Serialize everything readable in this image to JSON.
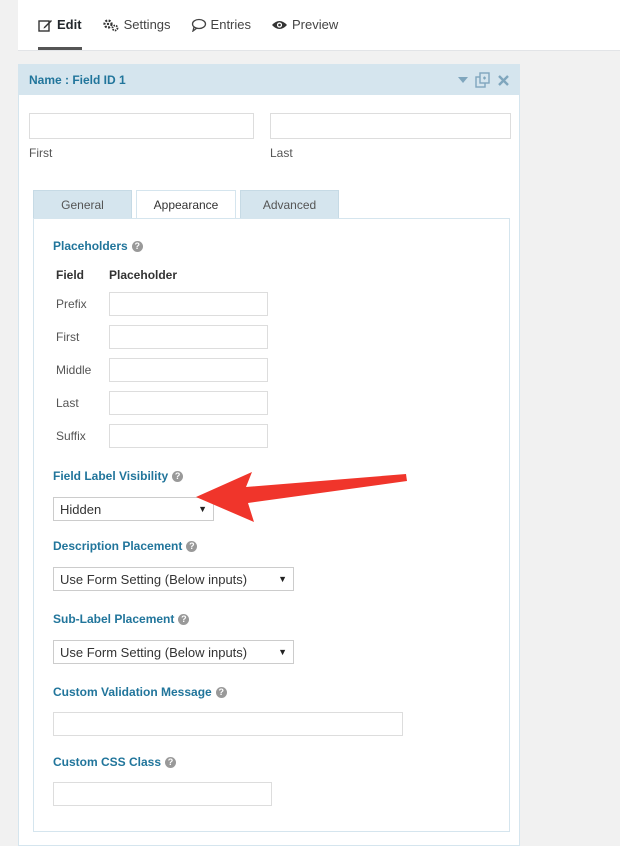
{
  "topnav": {
    "items": [
      {
        "label": "Edit",
        "icon": "edit-icon"
      },
      {
        "label": "Settings",
        "icon": "gear-icon"
      },
      {
        "label": "Entries",
        "icon": "comment-icon"
      },
      {
        "label": "Preview",
        "icon": "eye-icon"
      }
    ]
  },
  "panel": {
    "title": "Name : Field ID 1",
    "first_label": "First",
    "last_label": "Last"
  },
  "tabs": [
    {
      "label": "General"
    },
    {
      "label": "Appearance"
    },
    {
      "label": "Advanced"
    }
  ],
  "placeholders": {
    "title": "Placeholders",
    "col_field": "Field",
    "col_placeholder": "Placeholder",
    "rows": [
      {
        "label": "Prefix"
      },
      {
        "label": "First"
      },
      {
        "label": "Middle"
      },
      {
        "label": "Last"
      },
      {
        "label": "Suffix"
      }
    ]
  },
  "label_visibility": {
    "title": "Field Label Visibility",
    "value": "Hidden"
  },
  "description_placement": {
    "title": "Description Placement",
    "value": "Use Form Setting (Below inputs)"
  },
  "sublabel_placement": {
    "title": "Sub-Label Placement",
    "value": "Use Form Setting (Below inputs)"
  },
  "validation": {
    "title": "Custom Validation Message"
  },
  "css_class": {
    "title": "Custom CSS Class"
  },
  "help_glyph": "?",
  "colors": {
    "accent": "#21759b",
    "header_bg": "#d5e5ee",
    "arrow": "#f0352b"
  }
}
